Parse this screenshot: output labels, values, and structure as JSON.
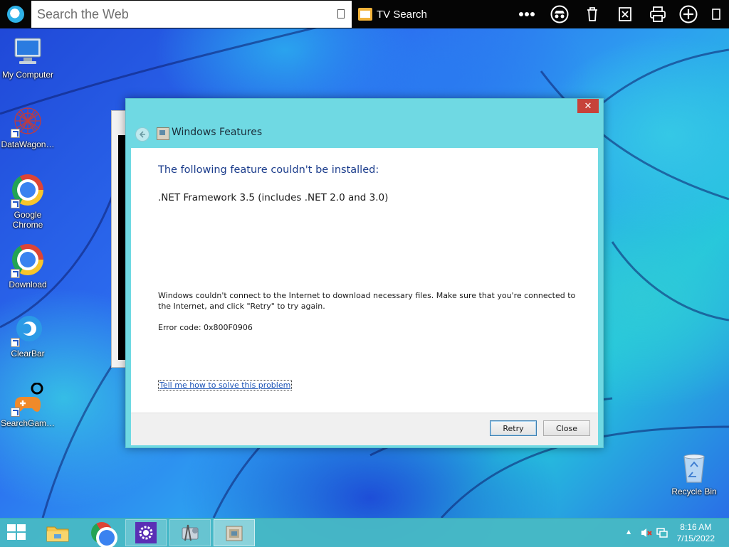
{
  "browser_bar": {
    "search_placeholder": "Search the Web",
    "tv_search_label": "TV Search",
    "icons": [
      "more-icon",
      "incognito-icon",
      "trash-icon",
      "share-icon",
      "print-icon",
      "add-tab-icon",
      "tabs-icon"
    ]
  },
  "desktop": {
    "icons": [
      {
        "label": "My Computer",
        "icon": "computer-icon"
      },
      {
        "label": "DataWagon…",
        "icon": "datawagon-icon"
      },
      {
        "label": "Google Chrome",
        "icon": "chrome-icon"
      },
      {
        "label": "Download",
        "icon": "chrome-icon"
      },
      {
        "label": "ClearBar",
        "icon": "clearbar-icon"
      },
      {
        "label": "SearchGam…",
        "icon": "gamepad-icon"
      },
      {
        "label": "Recycle Bin",
        "icon": "recycle-bin-icon"
      }
    ]
  },
  "dialog": {
    "title": "Windows Features",
    "close_glyph": "✕",
    "heading": "The following feature couldn't be installed:",
    "feature": ".NET Framework 3.5 (includes .NET 2.0 and 3.0)",
    "message": "Windows couldn't connect to the Internet to download necessary files. Make sure that you're connected to the Internet, and click \"Retry\" to try again.",
    "error_code": "Error code: 0x800F0906",
    "help_link": "Tell me how to solve this problem",
    "buttons": {
      "retry": "Retry",
      "close": "Close"
    }
  },
  "taskbar": {
    "apps": [
      "file-explorer-icon",
      "chrome-icon",
      "settings-gear-icon",
      "control-panel-icon",
      "windows-features-icon"
    ],
    "clock": {
      "time": "8:16 AM",
      "date": "7/15/2022"
    },
    "tray_up_arrow": "▲"
  }
}
